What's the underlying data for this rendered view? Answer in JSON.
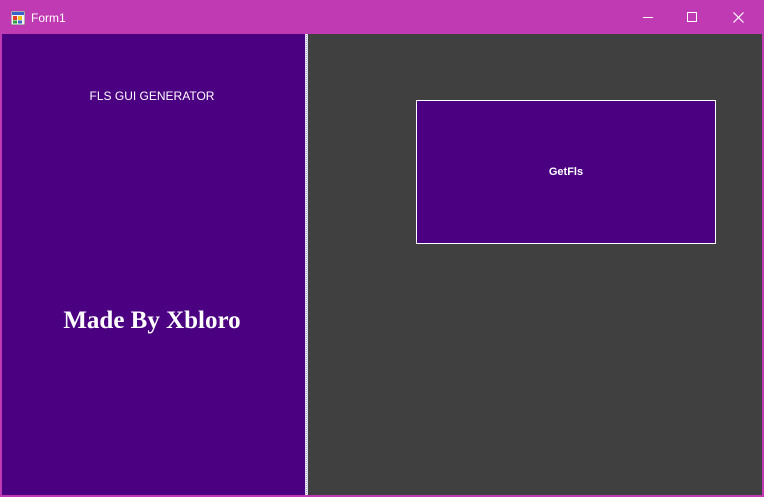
{
  "window": {
    "title": "Form1",
    "icon": "winforms-app-icon",
    "controls": {
      "minimize_icon": "minimize-icon",
      "maximize_icon": "maximize-icon",
      "close_icon": "close-icon"
    }
  },
  "left_panel": {
    "header_label": "FLS GUI GENERATOR",
    "credit_label": "Made By Xbloro"
  },
  "main": {
    "getfls_button_label": "GetFls"
  },
  "colors": {
    "titlebar": "#c03ab4",
    "panel_purple": "#4b0082",
    "client_background": "#404040",
    "text": "#ffffff"
  }
}
